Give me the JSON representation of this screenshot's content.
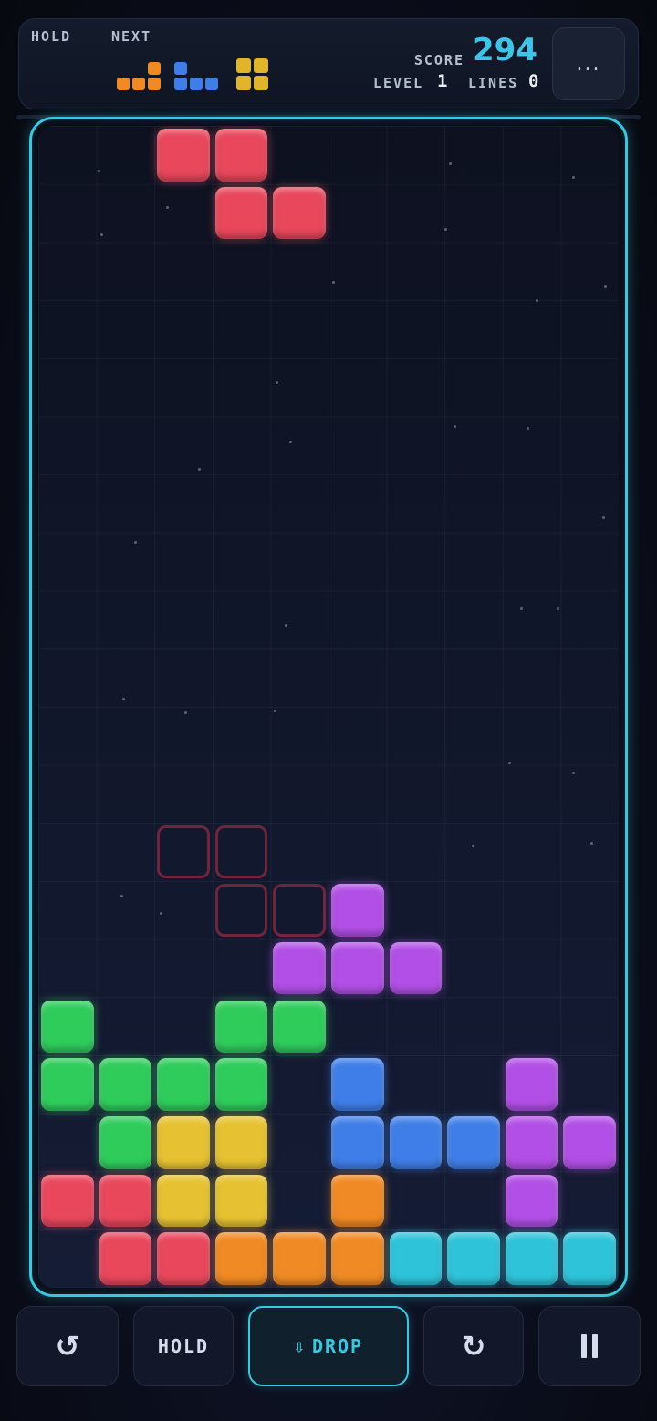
{
  "header": {
    "hold_label": "HOLD",
    "next_label": "NEXT",
    "score_label": "SCORE",
    "score_value": "294",
    "level_label": "LEVEL",
    "level_value": "1",
    "lines_label": "LINES",
    "lines_value": "0",
    "menu_label": "..."
  },
  "next_queue": [
    {
      "piece": "L",
      "color": "#f08a24"
    },
    {
      "piece": "J",
      "color": "#3f7ee8"
    },
    {
      "piece": "O",
      "color": "#e0b52c"
    }
  ],
  "board": {
    "columns": 10,
    "rows": 20,
    "colors": {
      "red": "#e8475c",
      "green": "#2fcc5c",
      "yellow": "#e6c232",
      "blue": "#3f7ee8",
      "purple": "#b14fe6",
      "orange": "#f08a24",
      "cyan": "#2ec3d9",
      "ghost": "rgba(190,50,70,0.55)"
    },
    "active_piece": {
      "type": "Z",
      "color": "red",
      "cells": [
        [
          2,
          0
        ],
        [
          3,
          0
        ],
        [
          3,
          1
        ],
        [
          4,
          1
        ]
      ]
    },
    "ghost_piece": {
      "type": "Z",
      "cells": [
        [
          2,
          12
        ],
        [
          3,
          12
        ],
        [
          3,
          13
        ],
        [
          4,
          13
        ]
      ]
    },
    "locked": [
      {
        "col": 5,
        "row": 13,
        "color": "purple"
      },
      {
        "col": 4,
        "row": 14,
        "color": "purple"
      },
      {
        "col": 5,
        "row": 14,
        "color": "purple"
      },
      {
        "col": 6,
        "row": 14,
        "color": "purple"
      },
      {
        "col": 0,
        "row": 15,
        "color": "green"
      },
      {
        "col": 3,
        "row": 15,
        "color": "green"
      },
      {
        "col": 4,
        "row": 15,
        "color": "green"
      },
      {
        "col": 0,
        "row": 16,
        "color": "green"
      },
      {
        "col": 1,
        "row": 16,
        "color": "green"
      },
      {
        "col": 2,
        "row": 16,
        "color": "green"
      },
      {
        "col": 3,
        "row": 16,
        "color": "green"
      },
      {
        "col": 5,
        "row": 16,
        "color": "blue"
      },
      {
        "col": 8,
        "row": 16,
        "color": "purple"
      },
      {
        "col": 1,
        "row": 17,
        "color": "green"
      },
      {
        "col": 2,
        "row": 17,
        "color": "yellow"
      },
      {
        "col": 3,
        "row": 17,
        "color": "yellow"
      },
      {
        "col": 5,
        "row": 17,
        "color": "blue"
      },
      {
        "col": 6,
        "row": 17,
        "color": "blue"
      },
      {
        "col": 7,
        "row": 17,
        "color": "blue"
      },
      {
        "col": 8,
        "row": 17,
        "color": "purple"
      },
      {
        "col": 9,
        "row": 17,
        "color": "purple"
      },
      {
        "col": 0,
        "row": 18,
        "color": "red"
      },
      {
        "col": 1,
        "row": 18,
        "color": "red"
      },
      {
        "col": 2,
        "row": 18,
        "color": "yellow"
      },
      {
        "col": 3,
        "row": 18,
        "color": "yellow"
      },
      {
        "col": 5,
        "row": 18,
        "color": "orange"
      },
      {
        "col": 8,
        "row": 18,
        "color": "purple"
      },
      {
        "col": 1,
        "row": 19,
        "color": "red"
      },
      {
        "col": 2,
        "row": 19,
        "color": "red"
      },
      {
        "col": 3,
        "row": 19,
        "color": "orange"
      },
      {
        "col": 4,
        "row": 19,
        "color": "orange"
      },
      {
        "col": 5,
        "row": 19,
        "color": "orange"
      },
      {
        "col": 6,
        "row": 19,
        "color": "cyan"
      },
      {
        "col": 7,
        "row": 19,
        "color": "cyan"
      },
      {
        "col": 8,
        "row": 19,
        "color": "cyan"
      },
      {
        "col": 9,
        "row": 19,
        "color": "cyan"
      }
    ]
  },
  "controls": {
    "rotate_left_icon": "rotate-ccw-icon",
    "hold_label": "HOLD",
    "drop_label": "DROP",
    "drop_icon": "⇩",
    "rotate_right_icon": "rotate-cw-icon",
    "pause_icon": "pause-icon"
  },
  "theme": {
    "accent": "#3cc6e0",
    "background": "#0b0f1e"
  }
}
